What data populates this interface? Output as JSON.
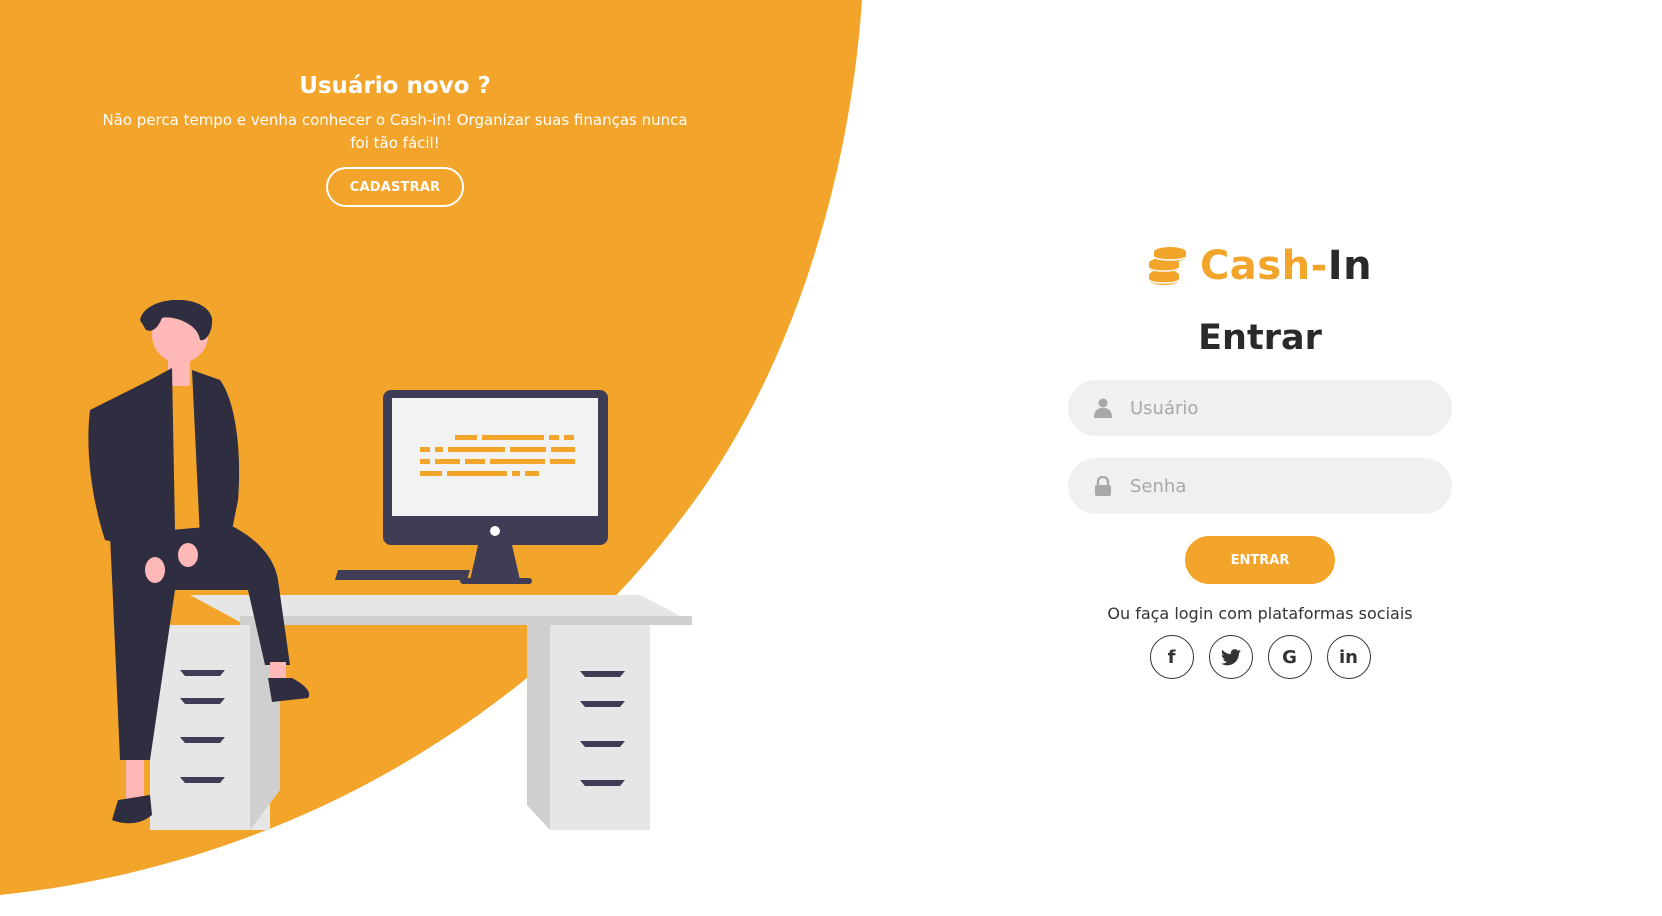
{
  "colors": {
    "accent": "#f3a42a",
    "dark": "#2a2a2a",
    "input_bg": "#f0f0f0"
  },
  "left": {
    "title": "Usuário novo ?",
    "description": "Não perca tempo e venha conhecer o Cash-in! Organizar suas finanças nunca foi tão fácil!",
    "signup_label": "CADASTRAR"
  },
  "logo": {
    "icon": "coins-icon",
    "part1": "Cash-",
    "part2": "In"
  },
  "form": {
    "title": "Entrar",
    "username_placeholder": "Usuário",
    "password_placeholder": "Senha",
    "submit_label": "ENTRAR"
  },
  "social": {
    "text": "Ou faça login com plataformas sociais",
    "items": [
      {
        "name": "facebook",
        "glyph": "f"
      },
      {
        "name": "twitter",
        "glyph": "t"
      },
      {
        "name": "google",
        "glyph": "G"
      },
      {
        "name": "linkedin",
        "glyph": "in"
      }
    ]
  }
}
